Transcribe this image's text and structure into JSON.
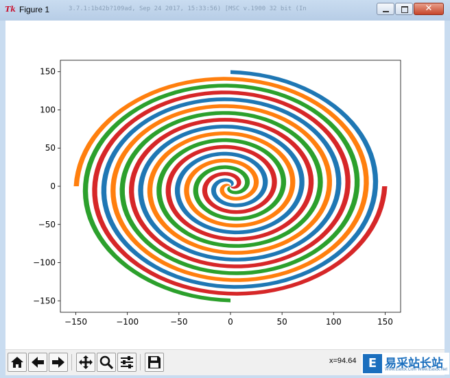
{
  "window": {
    "title": "Figure 1",
    "faded_title": "3.7.1:1b42b?109ad, Sep 24 2017, 15:33:56) [MSC v.1900 32 bit (In",
    "icon": "tk-feather-icon",
    "controls": {
      "minimize": "minimize-icon",
      "maximize": "maximize-icon",
      "close": "close-icon"
    }
  },
  "toolbar": {
    "buttons": [
      {
        "name": "home-button",
        "icon": "home-icon"
      },
      {
        "name": "back-button",
        "icon": "arrow-left-icon"
      },
      {
        "name": "forward-button",
        "icon": "arrow-right-icon"
      },
      {
        "name": "pan-button",
        "icon": "move-icon"
      },
      {
        "name": "zoom-button",
        "icon": "magnifier-icon"
      },
      {
        "name": "configure-subplots-button",
        "icon": "sliders-icon"
      },
      {
        "name": "save-button",
        "icon": "floppy-disk-icon"
      }
    ],
    "coordinates": "x=94.64"
  },
  "watermark": {
    "logo_letter": "E",
    "text": "易采站长站",
    "subtext": "Www.Easck.Com  Www.Easck.Net"
  },
  "chart_data": {
    "type": "area",
    "description_none": "",
    "xlim": [
      -165,
      165
    ],
    "ylim": [
      -165,
      165
    ],
    "xticks": [
      -150,
      -100,
      -50,
      0,
      50,
      100,
      150
    ],
    "yticks": [
      -150,
      -100,
      -50,
      0,
      50,
      100,
      150
    ],
    "grid": false,
    "series": [
      {
        "color": "#1f77b4",
        "start_angle_deg": 0
      },
      {
        "color": "#ff7f0e",
        "start_angle_deg": 90
      },
      {
        "color": "#2ca02c",
        "start_angle_deg": 180
      },
      {
        "color": "#d62728",
        "start_angle_deg": 270
      }
    ],
    "max_radius": 152,
    "turns": 4.25
  }
}
